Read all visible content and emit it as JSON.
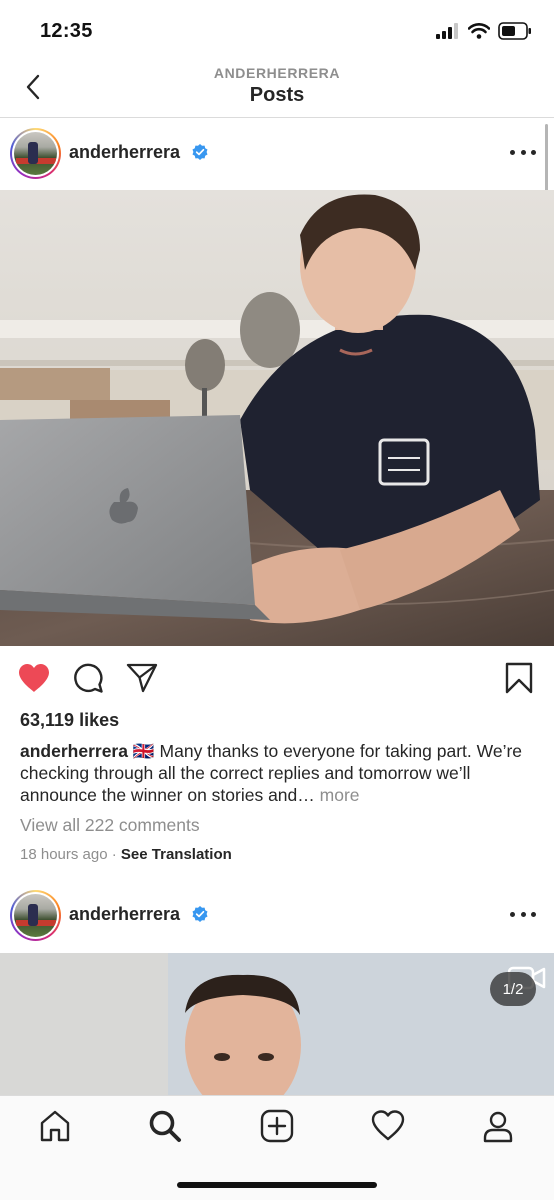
{
  "status": {
    "time": "12:35"
  },
  "header": {
    "account": "ANDERHERRERA",
    "title": "Posts"
  },
  "posts": [
    {
      "username": "anderherrera",
      "likes": "63,119 likes",
      "caption": {
        "user": "anderherrera",
        "flag": "🇬🇧",
        "text": "Many thanks to everyone for taking part. We’re checking through all the correct replies and tomorrow we’ll announce the winner on stories and…",
        "more": "more"
      },
      "comments_link": "View all 222 comments",
      "time": "18 hours ago",
      "separator": "·",
      "translate": "See Translation"
    },
    {
      "username": "anderherrera",
      "carousel_count": "1/2"
    }
  ],
  "colors": {
    "like_red": "#ed4956",
    "verified_blue": "#3897f0",
    "muted": "#8e8e8e"
  },
  "icons": [
    "back-icon",
    "verified-icon",
    "more-icon",
    "heart-filled-icon",
    "comment-icon",
    "share-icon",
    "bookmark-icon",
    "home-icon",
    "search-icon",
    "new-post-icon",
    "activity-heart-icon",
    "profile-icon",
    "video-icon"
  ]
}
